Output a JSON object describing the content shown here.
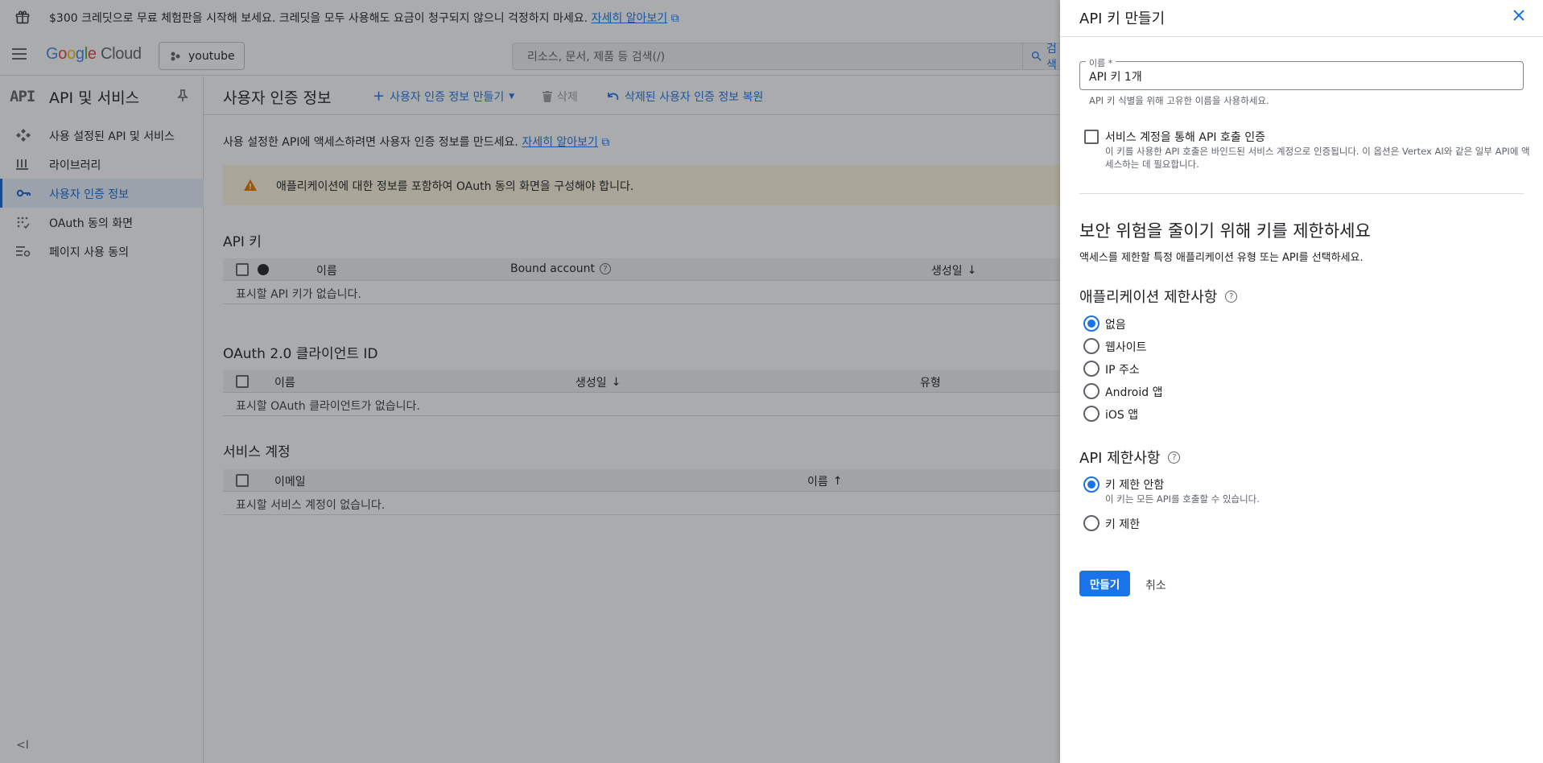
{
  "banner": {
    "text": "$300 크레딧으로 무료 체험판을 시작해 보세요. 크레딧을 모두 사용해도 요금이 청구되지 않으니 걱정하지 마세요.",
    "link": "자세히 알아보기"
  },
  "topbar": {
    "logo_google": [
      "G",
      "o",
      "o",
      "g",
      "l",
      "e"
    ],
    "logo_cloud": "Cloud",
    "project": "youtube",
    "search_placeholder": "리소스, 문서, 제품 등 검색(/)",
    "search_button": "검색"
  },
  "sidebar": {
    "logo": "API",
    "title": "API 및 서비스",
    "items": [
      {
        "label": "사용 설정된 API 및 서비스",
        "icon": "enabled-apis-icon"
      },
      {
        "label": "라이브러리",
        "icon": "library-icon"
      },
      {
        "label": "사용자 인증 정보",
        "icon": "key-icon"
      },
      {
        "label": "OAuth 동의 화면",
        "icon": "oauth-icon"
      },
      {
        "label": "페이지 사용 동의",
        "icon": "settings-list-icon"
      }
    ],
    "collapse": "<I"
  },
  "main": {
    "title": "사용자 인증 정보",
    "toolbar": {
      "create": "사용자 인증 정보 만들기",
      "delete": "삭제",
      "restore": "삭제된 사용자 인증 정보 복원"
    },
    "intro": "사용 설정한 API에 액세스하려면 사용자 인증 정보를 만드세요.",
    "intro_link": "자세히 알아보기",
    "warning": "애플리케이션에 대한 정보를 포함하여 OAuth 동의 화면을 구성해야 합니다.",
    "api_keys": {
      "title": "API 키",
      "columns": [
        "이름",
        "Bound account",
        "생성일"
      ],
      "empty": "표시할 API 키가 없습니다."
    },
    "oauth": {
      "title": "OAuth 2.0 클라이언트 ID",
      "columns": [
        "이름",
        "생성일",
        "유형"
      ],
      "empty": "표시할 OAuth 클라이언트가 없습니다."
    },
    "service_accounts": {
      "title": "서비스 계정",
      "columns": [
        "이메일",
        "이름"
      ],
      "empty": "표시할 서비스 계정이 없습니다."
    }
  },
  "panel": {
    "title": "API 키 만들기",
    "name_label": "이름 *",
    "name_value": "API 키 1개",
    "name_hint": "API 키 식별을 위해 고유한 이름을 사용하세요.",
    "service_auth_label": "서비스 계정을 통해 API 호출 인증",
    "service_auth_desc": "이 키를 사용한 API 호출은 바인드된 서비스 계정으로 인증됩니다. 이 옵션은 Vertex AI와 같은 일부 API에 액세스하는 데 필요합니다.",
    "restrict_title": "보안 위험을 줄이기 위해 키를 제한하세요",
    "restrict_desc": "액세스를 제한할 특정 애플리케이션 유형 또는 API를 선택하세요.",
    "app_restrictions_title": "애플리케이션 제한사항",
    "app_options": [
      "없음",
      "웹사이트",
      "IP 주소",
      "Android 앱",
      "iOS 앱"
    ],
    "app_selected": "없음",
    "api_restrictions_title": "API 제한사항",
    "api_options": [
      "키 제한 안함",
      "키 제한"
    ],
    "api_option_desc": "이 키는 모든 API를 호출할 수 있습니다.",
    "api_selected": "키 제한 안함",
    "create_button": "만들기",
    "cancel_button": "취소"
  },
  "colors": {
    "accent": "#1a73e8",
    "warning_bg": "#fef7e0",
    "warning_icon": "#e37400",
    "active_nav_bg": "#e8f0fe"
  }
}
